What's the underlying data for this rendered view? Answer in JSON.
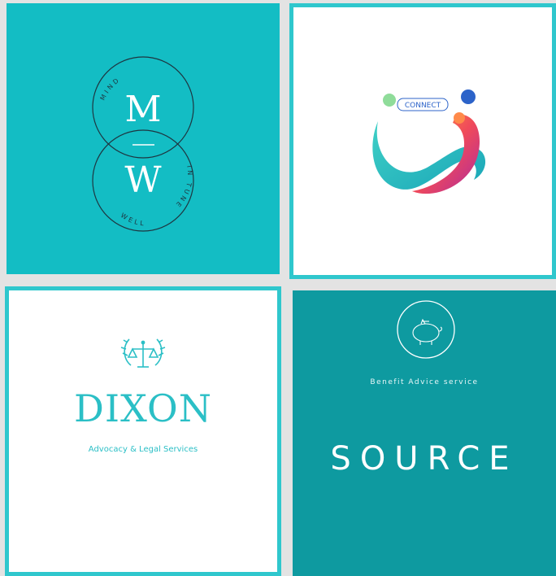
{
  "tiles": [
    {
      "id": "mw",
      "top_letter": "M",
      "bottom_letter": "W",
      "ring_text_top": "MIND",
      "ring_text_right": "IN TUNE",
      "ring_text_bottom": "WELL",
      "background": "#13bdc4"
    },
    {
      "id": "connect",
      "badge": "CONNECT",
      "subtitle": "",
      "tagline": "",
      "background": "#ffffff",
      "border": "#2fc7cd"
    },
    {
      "id": "dixon",
      "name": "DIXON",
      "subtitle": "Advocacy & Legal Services",
      "icon": "scales-of-justice-icon",
      "background": "#ffffff",
      "border": "#2fc7cd"
    },
    {
      "id": "source",
      "tagline": "Benefit Advice service",
      "name": "SOURCE",
      "icon": "piggy-bank-icon",
      "background": "#0e9aa0"
    }
  ]
}
